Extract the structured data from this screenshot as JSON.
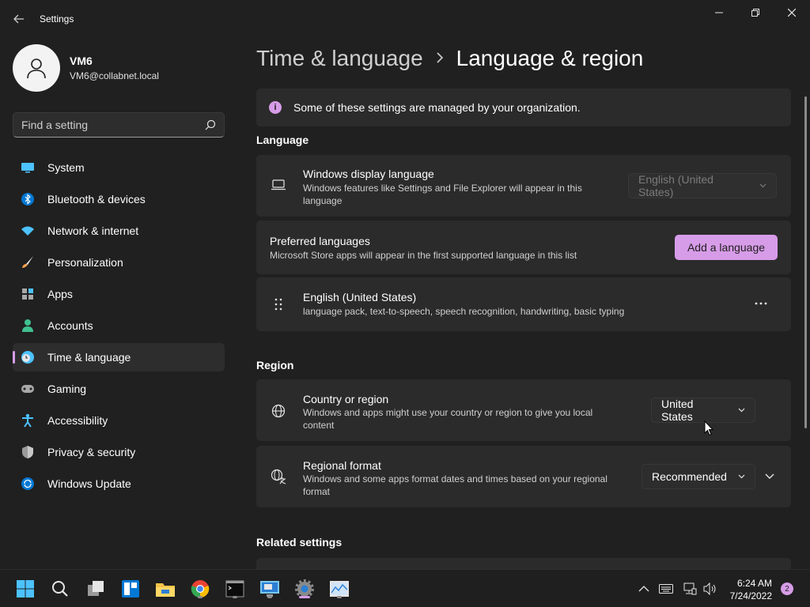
{
  "window": {
    "title": "Settings"
  },
  "user": {
    "name": "VM6",
    "email": "VM6@collabnet.local"
  },
  "search": {
    "placeholder": "Find a setting"
  },
  "nav": [
    {
      "label": "System",
      "icon": "monitor-icon"
    },
    {
      "label": "Bluetooth & devices",
      "icon": "bluetooth-icon"
    },
    {
      "label": "Network & internet",
      "icon": "wifi-icon"
    },
    {
      "label": "Personalization",
      "icon": "brush-icon"
    },
    {
      "label": "Apps",
      "icon": "apps-icon"
    },
    {
      "label": "Accounts",
      "icon": "person-icon"
    },
    {
      "label": "Time & language",
      "icon": "clock-globe-icon",
      "active": true
    },
    {
      "label": "Gaming",
      "icon": "gamepad-icon"
    },
    {
      "label": "Accessibility",
      "icon": "accessibility-icon"
    },
    {
      "label": "Privacy & security",
      "icon": "shield-icon"
    },
    {
      "label": "Windows Update",
      "icon": "update-icon"
    }
  ],
  "breadcrumb": {
    "parent": "Time & language",
    "current": "Language & region"
  },
  "banner": {
    "text": "Some of these settings are managed by your organization."
  },
  "language": {
    "section_title": "Language",
    "display": {
      "title": "Windows display language",
      "desc": "Windows features like Settings and File Explorer will appear in this language",
      "value": "English (United States)"
    },
    "preferred": {
      "title": "Preferred languages",
      "desc": "Microsoft Store apps will appear in the first supported language in this list",
      "button": "Add a language"
    },
    "english": {
      "title": "English (United States)",
      "desc": "language pack, text-to-speech, speech recognition, handwriting, basic typing"
    }
  },
  "region": {
    "section_title": "Region",
    "country": {
      "title": "Country or region",
      "desc": "Windows and apps might use your country or region to give you local content",
      "value": "United States"
    },
    "format": {
      "title": "Regional format",
      "desc": "Windows and some apps format dates and times based on your regional format",
      "value": "Recommended"
    }
  },
  "related": {
    "section_title": "Related settings"
  },
  "taskbar": {
    "time": "6:24 AM",
    "date": "7/24/2022",
    "notifications": "2"
  },
  "colors": {
    "accent": "#d79ce8",
    "background": "#202020",
    "card": "#2b2b2b"
  }
}
